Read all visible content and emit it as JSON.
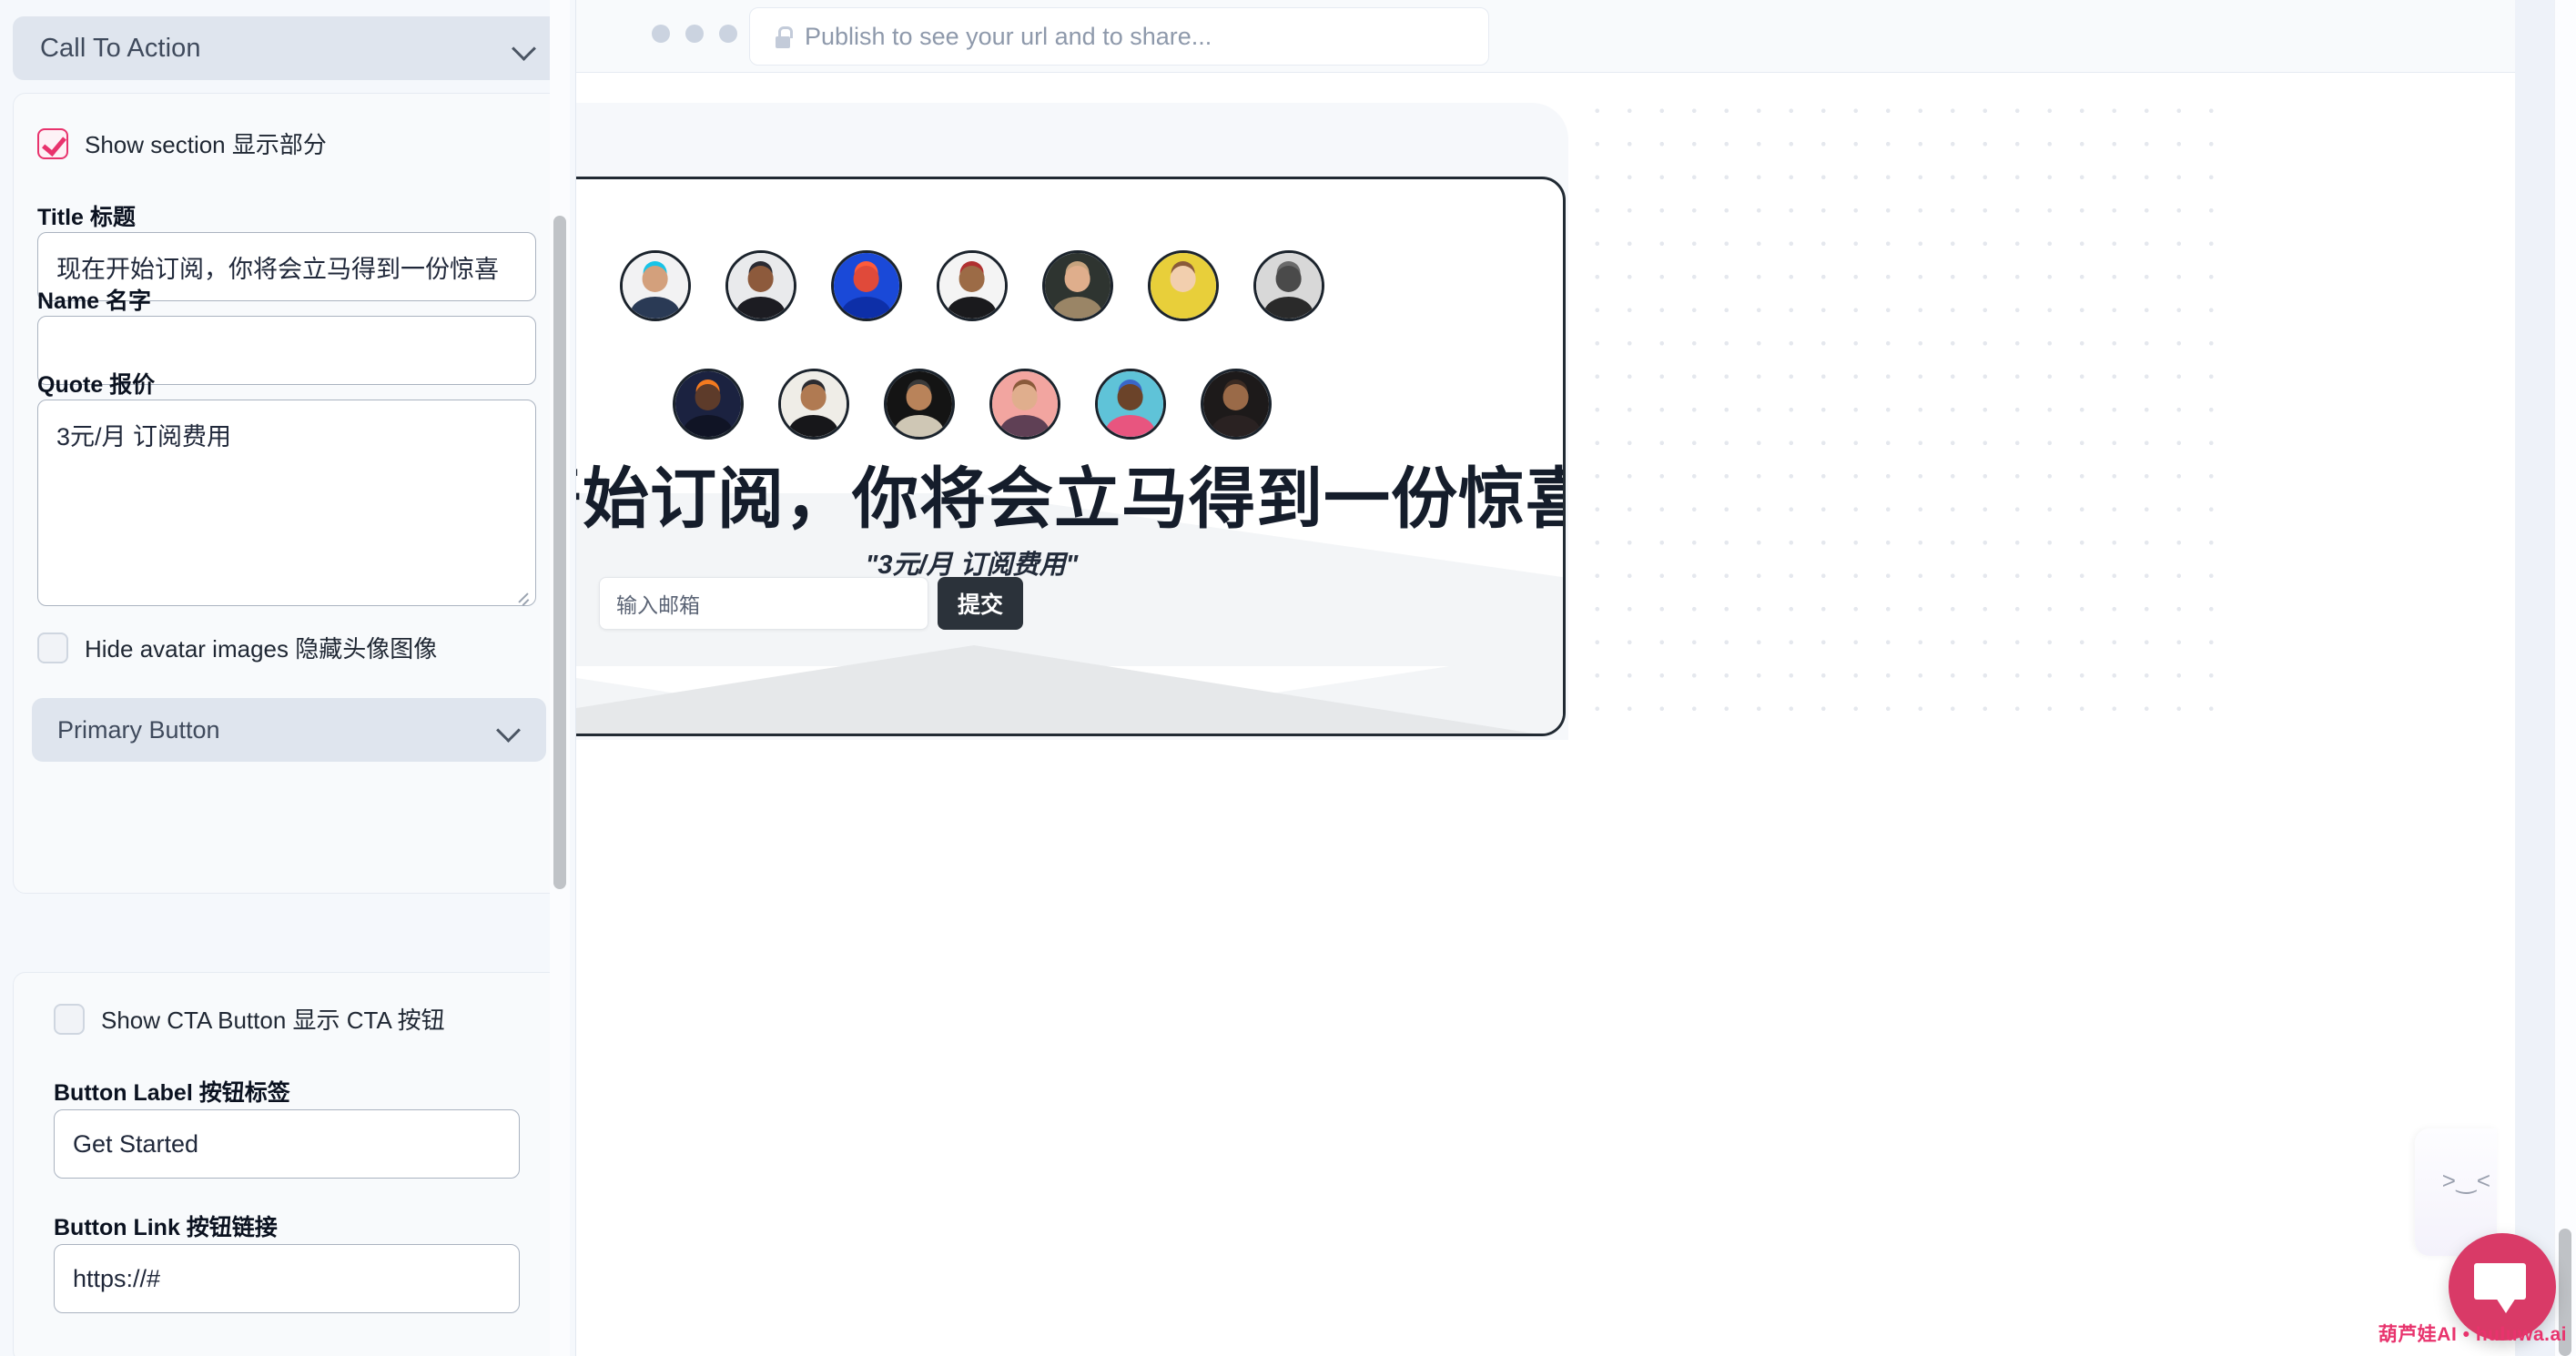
{
  "sidebar": {
    "section_title": "Call To Action",
    "chevron_icon": "chevron-down-icon",
    "show_section": {
      "label": "Show section 显示部分",
      "checked": true
    },
    "title_field": {
      "label": "Title 标题",
      "value": "现在开始订阅，你将会立马得到一份惊喜"
    },
    "name_field": {
      "label": "Name 名字",
      "value": "",
      "placeholder": ""
    },
    "quote_field": {
      "label": "Quote 报价",
      "value": "3元/月 订阅费用"
    },
    "hide_avatars": {
      "label": "Hide avatar images 隐藏头像图像",
      "checked": false
    },
    "primary_button_section": "Primary Button",
    "show_cta_button": {
      "label": "Show CTA Button 显示 CTA 按钮",
      "checked": false
    },
    "button_label_field": {
      "label": "Button Label 按钮标签",
      "value": "Get Started"
    },
    "button_link_field": {
      "label": "Button Link 按钮链接",
      "value": "https://#"
    }
  },
  "browser": {
    "lock_icon": "lock-icon",
    "url_placeholder": "Publish to see your url and to share...",
    "traffic_lights": [
      "dot-1",
      "dot-2",
      "dot-3"
    ]
  },
  "preview": {
    "headline": "现在开始订阅，你将会立马得到一份惊喜.",
    "quote": "\"3元/月 订阅费用\"",
    "email_placeholder": "输入邮箱",
    "submit_label": "提交",
    "avatars_row1": [
      {
        "name": "avatar-glitch-man",
        "bg": "#f2f2f3",
        "skin": "#d3a07c",
        "shirt": "#2a3a55",
        "accent": "#17c4e8"
      },
      {
        "name": "avatar-glasses-woman",
        "bg": "#e9eaec",
        "skin": "#8d5a3c",
        "shirt": "#1c1c22",
        "accent": "#2b2b33"
      },
      {
        "name": "avatar-blue-red-woman",
        "bg": "#1a49d8",
        "skin": "#e04a3a",
        "shirt": "#0d2fa8",
        "accent": "#ff5b3a"
      },
      {
        "name": "avatar-young-man-tee",
        "bg": "#f4f4f4",
        "skin": "#9c6b46",
        "shirt": "#1a1a1d",
        "accent": "#b03030"
      },
      {
        "name": "avatar-woman-dark-bg",
        "bg": "#2e3430",
        "skin": "#dfae8c",
        "shirt": "#9a8566",
        "accent": "#c6a37e"
      },
      {
        "name": "avatar-woman-yellow",
        "bg": "#e8cf3a",
        "skin": "#f2cfae",
        "shirt": "#e8cf3a",
        "accent": "#8a5a3a"
      },
      {
        "name": "avatar-bw-man",
        "bg": "#d8d8d8",
        "skin": "#4a4a4a",
        "shirt": "#2a2a2a",
        "accent": "#6b6b6b"
      }
    ],
    "avatars_row2": [
      {
        "name": "avatar-neon-man",
        "bg": "#1b2240",
        "skin": "#5d3b2a",
        "shirt": "#101425",
        "accent": "#f47a1f"
      },
      {
        "name": "avatar-beard-glasses",
        "bg": "#efede7",
        "skin": "#b07a52",
        "shirt": "#17171a",
        "accent": "#2b2b30"
      },
      {
        "name": "avatar-night-man",
        "bg": "#141414",
        "skin": "#b9835a",
        "shirt": "#cfc7b5",
        "accent": "#3a3a3a"
      },
      {
        "name": "avatar-pink-bg-man",
        "bg": "#f2a5a0",
        "skin": "#e0ae8d",
        "shirt": "#5f4055",
        "accent": "#8a5a3a"
      },
      {
        "name": "avatar-graffiti-man",
        "bg": "#5fc3d8",
        "skin": "#6b4329",
        "shirt": "#e8557f",
        "accent": "#3a66c8"
      },
      {
        "name": "avatar-curly-woman",
        "bg": "#1d1a1a",
        "skin": "#9a6a48",
        "shirt": "#2a2222",
        "accent": "#3a2a22"
      }
    ]
  },
  "chat": {
    "icon": "chat-bubble-icon",
    "color": "#d93a67"
  },
  "mini_widget": {
    "face": ">‿<"
  },
  "watermark": {
    "text": "葫芦娃AI • huluwa.ai",
    "color": "#e8336d"
  }
}
